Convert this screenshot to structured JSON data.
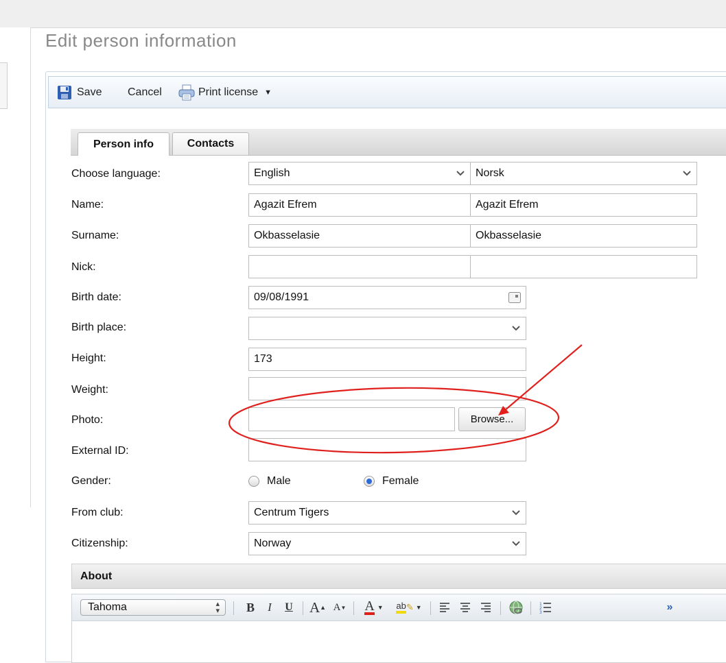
{
  "page": {
    "title": "Edit person information"
  },
  "toolbar": {
    "save": "Save",
    "cancel": "Cancel",
    "print_license": "Print license"
  },
  "tabs": [
    {
      "label": "Person info",
      "active": true
    },
    {
      "label": "Contacts",
      "active": false
    }
  ],
  "form": {
    "choose_language": {
      "label": "Choose language:",
      "value1": "English",
      "value2": "Norsk"
    },
    "name": {
      "label": "Name:",
      "value1": "Agazit Efrem",
      "value2": "Agazit Efrem"
    },
    "surname": {
      "label": "Surname:",
      "value1": "Okbasselasie",
      "value2": "Okbasselasie"
    },
    "nick": {
      "label": "Nick:",
      "value1": "",
      "value2": ""
    },
    "birth_date": {
      "label": "Birth date:",
      "value": "09/08/1991"
    },
    "birth_place": {
      "label": "Birth place:",
      "value": ""
    },
    "height": {
      "label": "Height:",
      "value": "173"
    },
    "weight": {
      "label": "Weight:",
      "value": ""
    },
    "photo": {
      "label": "Photo:",
      "value": "",
      "browse": "Browse..."
    },
    "external_id": {
      "label": "External ID:",
      "value": ""
    },
    "gender": {
      "label": "Gender:",
      "male": "Male",
      "female": "Female",
      "selected": "Female"
    },
    "from_club": {
      "label": "From club:",
      "value": "Centrum Tigers"
    },
    "citizenship": {
      "label": "Citizenship:",
      "value": "Norway"
    }
  },
  "about": {
    "label": "About",
    "font": "Tahoma",
    "buttons": {
      "bold": "B",
      "italic": "I",
      "underline": "U",
      "increase_font": "A",
      "decrease_font": "A",
      "font_color": "A",
      "highlight": "ab",
      "more": "»"
    }
  },
  "colors": {
    "annotation": "#e0201c",
    "accent": "#2c6bd6"
  }
}
